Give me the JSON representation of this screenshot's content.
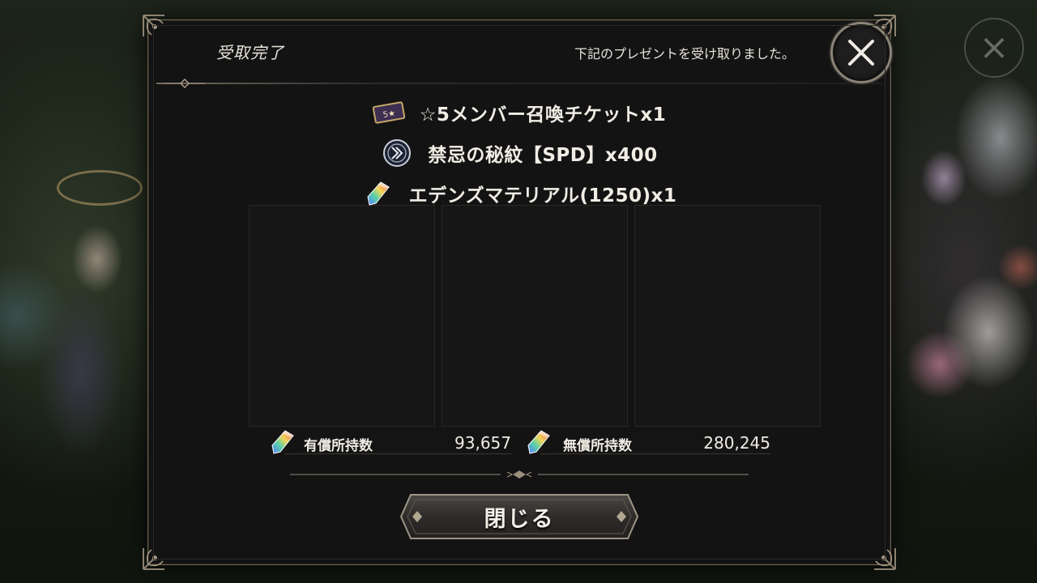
{
  "dialog": {
    "title": "受取完了",
    "message": "下記のプレゼントを受け取りました。"
  },
  "rewards": [
    {
      "label": "☆5メンバー召喚チケットx1",
      "icon": "ticket-icon"
    },
    {
      "label": "禁忌の秘紋【SPD】x400",
      "icon": "rune-icon"
    },
    {
      "label": "エデンズマテリアル(1250)x1",
      "icon": "crystal-icon"
    }
  ],
  "ticket_badge": "5★",
  "currency": {
    "paid_label": "有償所持数",
    "paid_value": "93,657",
    "free_label": "無償所持数",
    "free_value": "280,245"
  },
  "actions": {
    "close_label": "閉じる"
  },
  "colors": {
    "panel_bg": "#131313",
    "frame": "#6e6455",
    "text": "#f1ede5"
  }
}
